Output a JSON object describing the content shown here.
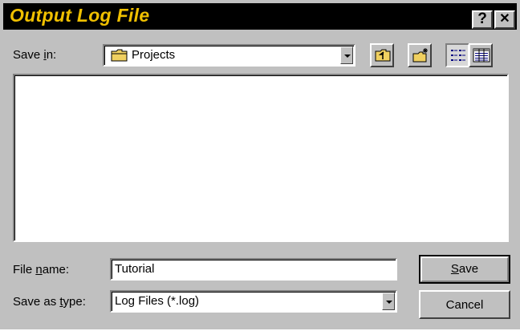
{
  "window": {
    "title": "Output Log File",
    "help_glyph": "?",
    "close_glyph": "✕"
  },
  "save_in": {
    "label_pre": "Save ",
    "label_key": "i",
    "label_post": "n:",
    "value": "Projects",
    "icon": "folder-icon"
  },
  "toolbar": {
    "up_folder_icon": "up-one-level-icon",
    "new_folder_icon": "new-folder-icon",
    "list_view_icon": "list-view-icon",
    "details_view_icon": "details-view-icon"
  },
  "file_list": {
    "items": []
  },
  "file_name": {
    "label_pre": "File ",
    "label_key": "n",
    "label_post": "ame:",
    "value": "Tutorial"
  },
  "save_as_type": {
    "label_pre": "Save as ",
    "label_key": "t",
    "label_post": "ype:",
    "value": "Log Files (*.log)"
  },
  "buttons": {
    "save_key": "S",
    "save_rest": "ave",
    "cancel": "Cancel"
  },
  "colors": {
    "title_bar": "#000000",
    "title_text": "#f0c000",
    "dialog_face": "#c0c0c0",
    "folder_yellow": "#f0d060"
  }
}
